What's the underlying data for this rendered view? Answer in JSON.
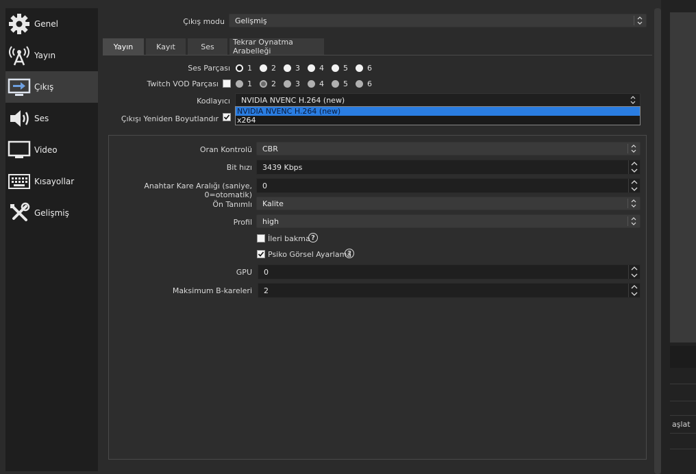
{
  "sidebar": {
    "items": [
      {
        "label": "Genel",
        "icon": "gear-icon"
      },
      {
        "label": "Yayın",
        "icon": "broadcast-icon"
      },
      {
        "label": "Çıkış",
        "icon": "output-icon"
      },
      {
        "label": "Ses",
        "icon": "speaker-icon"
      },
      {
        "label": "Video",
        "icon": "monitor-icon"
      },
      {
        "label": "Kısayollar",
        "icon": "keyboard-icon"
      },
      {
        "label": "Gelişmiş",
        "icon": "tools-icon"
      }
    ],
    "active_index": 2
  },
  "output_mode": {
    "label": "Çıkış modu",
    "value": "Gelişmiş"
  },
  "tabs": [
    {
      "label": "Yayın",
      "active": true
    },
    {
      "label": "Kayıt",
      "active": false
    },
    {
      "label": "Ses",
      "active": false
    },
    {
      "label": "Tekrar Oynatma Arabelleği",
      "active": false
    }
  ],
  "audio_track": {
    "label": "Ses Parçası",
    "options": [
      "1",
      "2",
      "3",
      "4",
      "5",
      "6"
    ],
    "selected": "1"
  },
  "twitch_vod": {
    "label": "Twitch VOD Parçası",
    "options": [
      "1",
      "2",
      "3",
      "4",
      "5",
      "6"
    ],
    "selected": "2",
    "checked": false
  },
  "encoder": {
    "label": "Kodlayıcı",
    "value": "NVIDIA NVENC H.264 (new)",
    "options": [
      "NVIDIA NVENC H.264 (new)",
      "x264"
    ],
    "highlighted": "NVIDIA NVENC H.264 (new)"
  },
  "rescale": {
    "label": "Çıkışı Yeniden Boyutlandır",
    "checked": true
  },
  "settings": {
    "rate_control": {
      "label": "Oran Kontrolü",
      "value": "CBR"
    },
    "bitrate": {
      "label": "Bit hızı",
      "value": "3439 Kbps"
    },
    "keyframe": {
      "label": "Anahtar Kare Aralığı (saniye, 0=otomatik)",
      "value": "0"
    },
    "preset": {
      "label": "Ön Tanımlı",
      "value": "Kalite"
    },
    "profile": {
      "label": "Profil",
      "value": "high"
    },
    "lookahead": {
      "label": "İleri bakma",
      "checked": false
    },
    "psycho": {
      "label": "Psiko Görsel Ayarlama",
      "checked": true
    },
    "gpu": {
      "label": "GPU",
      "value": "0"
    },
    "bframes": {
      "label": "Maksimum B-kareleri",
      "value": "2"
    }
  },
  "right_panel": {
    "partial_text": "aşlat"
  },
  "colors": {
    "highlight": "#2a7de1",
    "sidebar_bg": "#1e1e1e",
    "panel_bg": "#2b2b2b"
  }
}
